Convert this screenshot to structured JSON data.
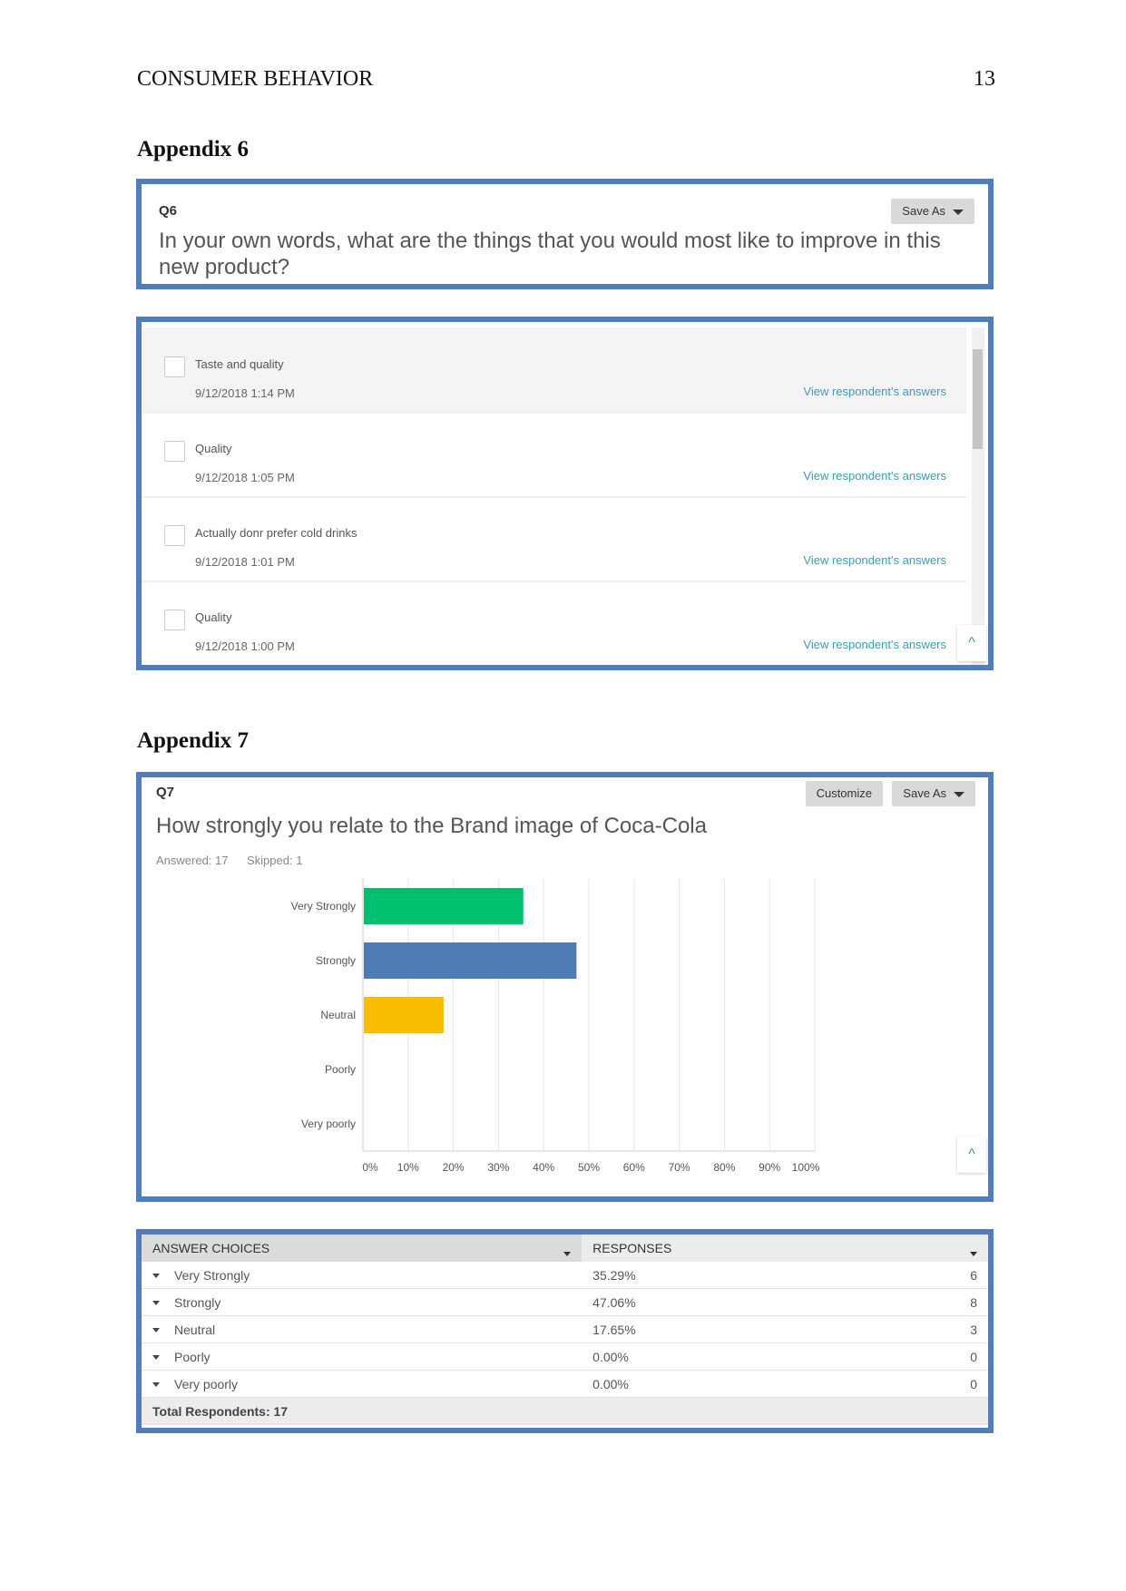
{
  "page": {
    "running_head": "CONSUMER BEHAVIOR",
    "page_number": "13"
  },
  "appendix6": {
    "title": "Appendix 6",
    "question_id": "Q6",
    "question_text": "In your own words, what are the things that you would most like to improve in this new product?",
    "save_as_label": "Save As",
    "responses": [
      {
        "text": "Taste and quality",
        "date": "9/12/2018 1:14 PM",
        "link": "View respondent's answers"
      },
      {
        "text": "Quality",
        "date": "9/12/2018 1:05 PM",
        "link": "View respondent's answers"
      },
      {
        "text": "Actually donr prefer cold drinks",
        "date": "9/12/2018 1:01 PM",
        "link": "View respondent's answers"
      },
      {
        "text": "Quality",
        "date": "9/12/2018 1:00 PM",
        "link": "View respondent's answers"
      }
    ],
    "scroll_up_icon": "^"
  },
  "appendix7": {
    "title": "Appendix 7",
    "question_id": "Q7",
    "question_text": "How strongly you relate to the Brand image of Coca-Cola",
    "customize_label": "Customize",
    "save_as_label": "Save As",
    "answered": "Answered: 17",
    "skipped": "Skipped: 1",
    "scroll_up_icon": "^",
    "table": {
      "headers": [
        "ANSWER CHOICES",
        "RESPONSES"
      ],
      "rows": [
        {
          "choice": "Very Strongly",
          "percent": "35.29%",
          "count": "6"
        },
        {
          "choice": "Strongly",
          "percent": "47.06%",
          "count": "8"
        },
        {
          "choice": "Neutral",
          "percent": "17.65%",
          "count": "3"
        },
        {
          "choice": "Poorly",
          "percent": "0.00%",
          "count": "0"
        },
        {
          "choice": "Very poorly",
          "percent": "0.00%",
          "count": "0"
        }
      ],
      "total": "Total Respondents: 17"
    }
  },
  "chart_data": {
    "type": "bar",
    "orientation": "horizontal",
    "title": "How strongly you relate to the Brand image of Coca-Cola",
    "categories": [
      "Very Strongly",
      "Strongly",
      "Neutral",
      "Poorly",
      "Very poorly"
    ],
    "values": [
      35.29,
      47.06,
      17.65,
      0,
      0
    ],
    "colors": [
      "#00bf6f",
      "#507cb6",
      "#f9be00",
      "#6bc8cd",
      "#ff8b4f"
    ],
    "xlabel": "",
    "ylabel": "",
    "xlim": [
      0,
      100
    ],
    "xticks": [
      "0%",
      "10%",
      "20%",
      "30%",
      "40%",
      "50%",
      "60%",
      "70%",
      "80%",
      "90%",
      "100%"
    ],
    "grid": true
  }
}
